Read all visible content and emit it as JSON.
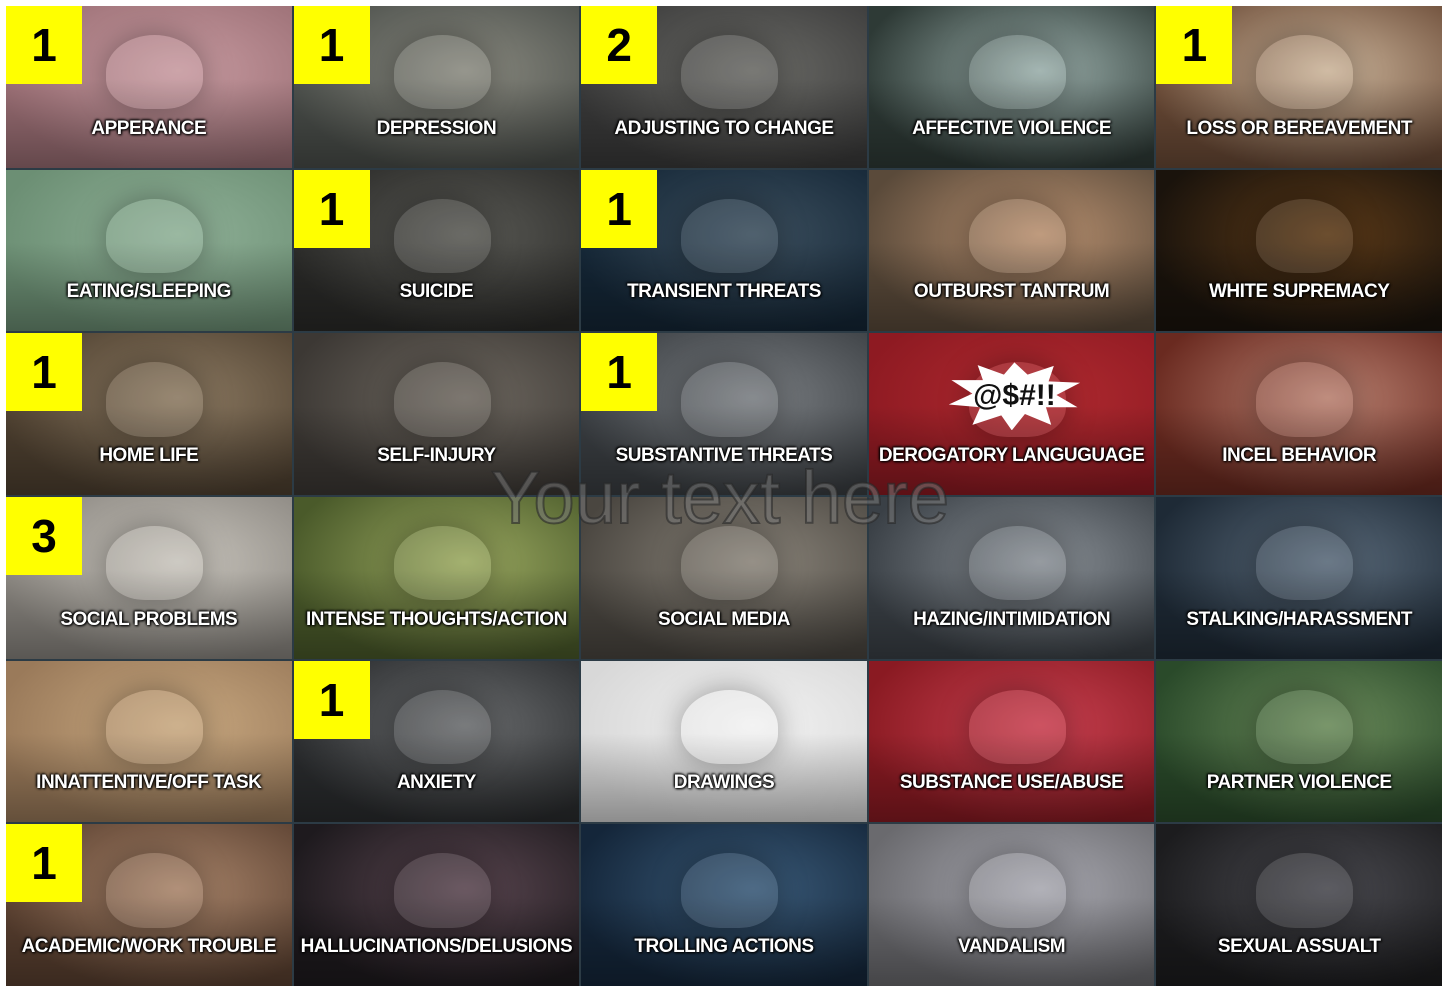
{
  "overlay_text": "Your text here",
  "tiles": [
    {
      "label": "APPERANCE",
      "badge": "1",
      "bg": "#9a6e74",
      "bg2": "#c79aa0",
      "icon": "torn-fabric-icon"
    },
    {
      "label": "DEPRESSION",
      "badge": "1",
      "bg": "#4a4e4a",
      "bg2": "#8a8a80",
      "icon": "sad-person-icon"
    },
    {
      "label": "ADJUSTING TO CHANGE",
      "badge": "2",
      "bg": "#3a3a3a",
      "bg2": "#6a6a66",
      "icon": "sprout-icon"
    },
    {
      "label": "AFFECTIVE VIOLENCE",
      "badge": "",
      "bg": "#2e3a36",
      "bg2": "#9aaeaa",
      "icon": "angry-face-icon"
    },
    {
      "label": "LOSS OR BEREAVEMENT",
      "badge": "1",
      "bg": "#6a4a36",
      "bg2": "#cbb49a",
      "icon": "grieving-person-icon"
    },
    {
      "label": "EATING/SLEEPING",
      "badge": "",
      "bg": "#6c8f74",
      "bg2": "#8fb097",
      "icon": "empty-plate-icon"
    },
    {
      "label": "SUICIDE",
      "badge": "1",
      "bg": "#2a2a28",
      "bg2": "#5a5a55",
      "icon": "hunched-person-icon"
    },
    {
      "label": "TRANSIENT THREATS",
      "badge": "1",
      "bg": "#142636",
      "bg2": "#3c4f5e",
      "icon": "gamer-headset-icon"
    },
    {
      "label": "OUTBURST TANTRUM",
      "badge": "",
      "bg": "#5a4a3a",
      "bg2": "#b89070",
      "icon": "screaming-child-icon"
    },
    {
      "label": "WHITE SUPREMACY",
      "badge": "",
      "bg": "#1a130c",
      "bg2": "#5c3a18",
      "icon": "torch-rally-icon"
    },
    {
      "label": "HOME LIFE",
      "badge": "1",
      "bg": "#4e4030",
      "bg2": "#8c7a62",
      "icon": "messy-room-icon"
    },
    {
      "label": "SELF-INJURY",
      "badge": "",
      "bg": "#3c3834",
      "bg2": "#6e6860",
      "icon": "knife-icon"
    },
    {
      "label": "SUBSTANTIVE THREATS",
      "badge": "1",
      "bg": "#3a3e42",
      "bg2": "#7a7e82",
      "icon": "fist-icon"
    },
    {
      "label": "DEROGATORY LANGUGUAGE",
      "badge": "",
      "bg": "#8e1a22",
      "bg2": "#b02a30",
      "icon": "curse-bubble-icon",
      "bubble": "@$#!!"
    },
    {
      "label": "INCEL BEHAVIOR",
      "badge": "",
      "bg": "#6a2a20",
      "bg2": "#b88070",
      "icon": "angry-man-icon"
    },
    {
      "label": "SOCIAL PROBLEMS",
      "badge": "3",
      "bg": "#8a8680",
      "bg2": "#c8c4bc",
      "icon": "stressed-woman-icon"
    },
    {
      "label": "INTENSE THOUGHTS/ACTION",
      "badge": "",
      "bg": "#4a5a2a",
      "bg2": "#9aa860",
      "icon": "frustrated-man-icon"
    },
    {
      "label": "SOCIAL MEDIA",
      "badge": "",
      "bg": "#4a4640",
      "bg2": "#8a847a",
      "icon": "phone-user-icon"
    },
    {
      "label": "HAZING/INTIMIDATION",
      "badge": "",
      "bg": "#3a4046",
      "bg2": "#8a9096",
      "icon": "group-bullying-icon"
    },
    {
      "label": "STALKING/HARASSMENT",
      "badge": "",
      "bg": "#1e2a36",
      "bg2": "#5a6a7a",
      "icon": "hooded-figure-icon"
    },
    {
      "label": "INNATTENTIVE/OFF TASK",
      "badge": "",
      "bg": "#9a7a5a",
      "bg2": "#c8a880",
      "icon": "arrow-blocks-icon"
    },
    {
      "label": "ANXIETY",
      "badge": "1",
      "bg": "#2a2c2e",
      "bg2": "#6a6c6e",
      "icon": "anxious-person-icon"
    },
    {
      "label": "DRAWINGS",
      "badge": "",
      "bg": "#d8d8d8",
      "bg2": "#f2f2f2",
      "icon": "sketch-rifle-icon"
    },
    {
      "label": "SUBSTANCE USE/ABUSE",
      "badge": "",
      "bg": "#8a1a22",
      "bg2": "#c84050",
      "icon": "red-cups-icon"
    },
    {
      "label": "PARTNER VIOLENCE",
      "badge": "",
      "bg": "#2a4a2a",
      "bg2": "#6a8a5a",
      "icon": "couple-park-icon"
    },
    {
      "label": "ACADEMIC/WORK TROUBLE",
      "badge": "1",
      "bg": "#5a4030",
      "bg2": "#a8846a",
      "icon": "stressed-student-icon"
    },
    {
      "label": "HALLUCINATIONS/DELUSIONS",
      "badge": "",
      "bg": "#1e1a1e",
      "bg2": "#5a4650",
      "icon": "blurred-face-icon"
    },
    {
      "label": "TROLLING ACTIONS",
      "badge": "",
      "bg": "#14263a",
      "bg2": "#3a5a78",
      "icon": "gnome-figures-icon"
    },
    {
      "label": "VANDALISM",
      "badge": "",
      "bg": "#6a6a6e",
      "bg2": "#a8a8b0",
      "icon": "graffiti-wall-icon"
    },
    {
      "label": "SEXUAL ASSUALT",
      "badge": "",
      "bg": "#1c1c1e",
      "bg2": "#4a4a50",
      "icon": "shadow-figure-icon"
    }
  ]
}
